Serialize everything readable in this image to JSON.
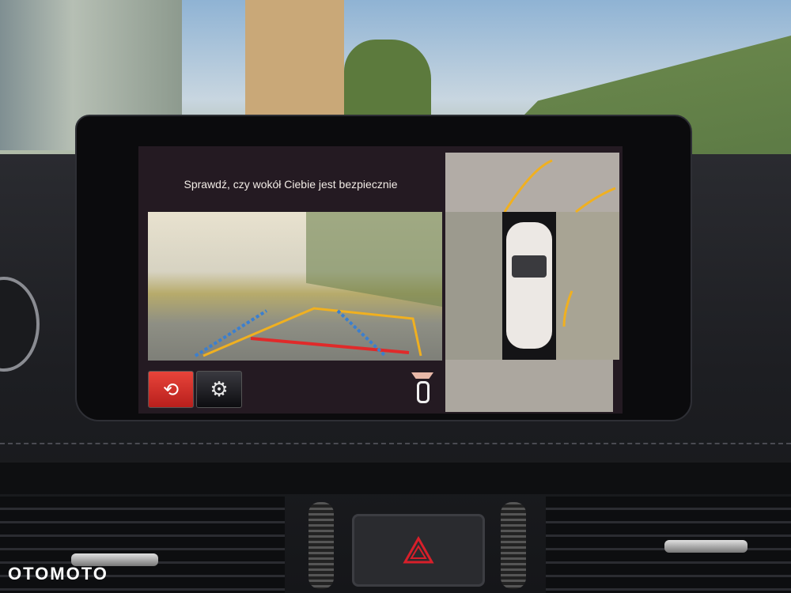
{
  "screen": {
    "message": "Sprawdź, czy wokół Ciebie jest bezpiecznie",
    "buttons": [
      {
        "icon": "camera-switch-icon",
        "active": true,
        "color": "#d8302a"
      },
      {
        "icon": "gear-icon",
        "active": false
      }
    ],
    "status_icon": "parking-sensor-car-icon",
    "views": [
      "rear-camera-view",
      "bird-eye-view"
    ],
    "guide_colors": {
      "near": "#e02a2a",
      "mid": "#f0b020",
      "width": "#3a7fd0"
    }
  },
  "console": {
    "hazard_icon": "hazard-triangle-icon",
    "hazard_color": "#d81f2a"
  },
  "watermark": "OTOMOTO"
}
